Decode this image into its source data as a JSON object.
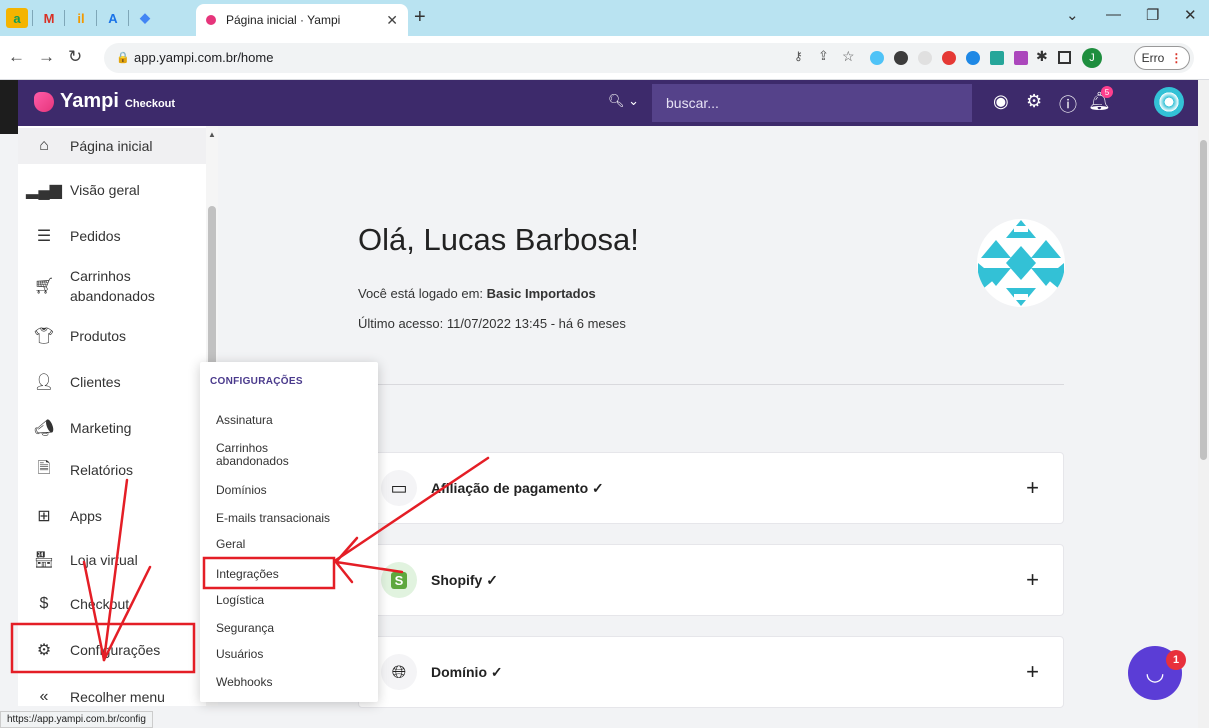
{
  "browser": {
    "tab_title": "Página inicial · Yampi",
    "url": "app.yampi.com.br/home",
    "status_url": "https://app.yampi.com.br/config",
    "error_label": "Erro",
    "profile_initial": "J",
    "pinned_tabs": [
      "a",
      "M",
      "il",
      "A",
      "◆"
    ]
  },
  "header": {
    "brand": "Yampi",
    "brand_sub": "Checkout",
    "search_placeholder": "buscar...",
    "notification_count": "5",
    "color": "#3d2a6b"
  },
  "sidebar": {
    "items": [
      {
        "label": "Página inicial",
        "icon": "home-icon"
      },
      {
        "label": "Visão geral",
        "icon": "bar-chart-icon"
      },
      {
        "label": "Pedidos",
        "icon": "list-icon"
      },
      {
        "label": "Carrinhos abandonados",
        "icon": "cart-icon"
      },
      {
        "label": "Produtos",
        "icon": "shirt-icon"
      },
      {
        "label": "Clientes",
        "icon": "user-icon"
      },
      {
        "label": "Marketing",
        "icon": "megaphone-icon"
      },
      {
        "label": "Relatórios",
        "icon": "report-icon"
      },
      {
        "label": "Apps",
        "icon": "apps-icon"
      },
      {
        "label": "Loja virtual",
        "icon": "store-icon"
      },
      {
        "label": "Checkout",
        "icon": "checkout-icon"
      },
      {
        "label": "Configurações",
        "icon": "gear-icon"
      },
      {
        "label": "Recolher menu",
        "icon": "collapse-icon"
      }
    ]
  },
  "main": {
    "greeting": "Olá, Lucas Barbosa!",
    "store_prefix": "Você está logado em: ",
    "store_name": "Basic Importados",
    "last_access": "Último acesso: 11/07/2022 13:45 - há 6 meses",
    "cards": [
      {
        "title": "Afiliação de pagamento ✓",
        "icon": "card-icon"
      },
      {
        "title": "Shopify ✓",
        "icon": "shopify-icon"
      },
      {
        "title": "Domínio ✓",
        "icon": "globe-icon"
      }
    ]
  },
  "flyout": {
    "title": "CONFIGURAÇÕES",
    "items": [
      "Assinatura",
      "Carrinhos abandonados",
      "Domínios",
      "E-mails transacionais",
      "Geral",
      "Integrações",
      "Logística",
      "Segurança",
      "Usuários",
      "Webhooks"
    ]
  },
  "chat": {
    "badge": "1"
  }
}
